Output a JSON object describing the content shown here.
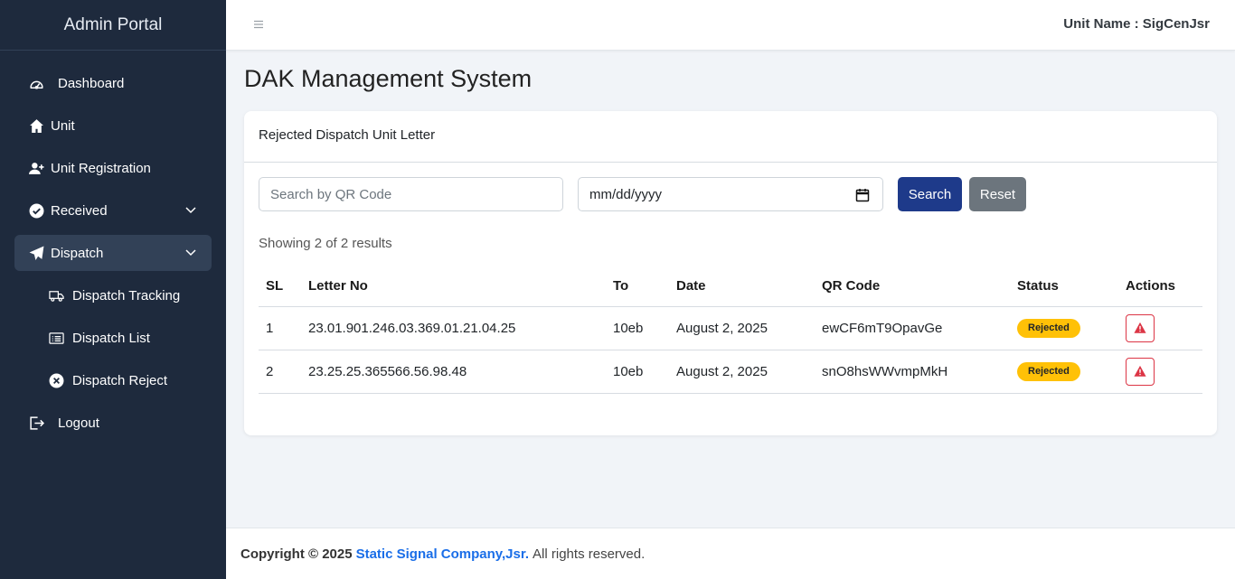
{
  "sidebar": {
    "brand": "Admin Portal",
    "items": [
      {
        "label": "Dashboard",
        "icon": "dashboard-gauge-icon"
      },
      {
        "label": "Unit",
        "icon": "house-icon"
      },
      {
        "label": "Unit Registration",
        "icon": "user-plus-icon"
      },
      {
        "label": "Received",
        "icon": "check-circle-icon"
      },
      {
        "label": "Dispatch",
        "icon": "paper-plane-icon"
      }
    ],
    "dispatch_sub": [
      {
        "label": "Dispatch Tracking",
        "icon": "truck-icon"
      },
      {
        "label": "Dispatch List",
        "icon": "list-icon"
      },
      {
        "label": "Dispatch Reject",
        "icon": "x-circle-icon"
      }
    ],
    "logout": "Logout"
  },
  "topbar": {
    "unit_name": "Unit Name : SigCenJsr"
  },
  "page": {
    "title": "DAK Management System"
  },
  "card": {
    "header": "Rejected Dispatch Unit Letter",
    "search_placeholder": "Search by QR Code",
    "date_placeholder": "mm/dd/yyyy",
    "search_button": "Search",
    "reset_button": "Reset",
    "showing": "Showing 2 of 2 results"
  },
  "table": {
    "columns": [
      "SL",
      "Letter No",
      "To",
      "Date",
      "QR Code",
      "Status",
      "Actions"
    ],
    "rows": [
      {
        "sl": "1",
        "letter_no": "23.01.901.246.03.369.01.21.04.25",
        "to": "10eb",
        "date": "August 2, 2025",
        "qr": "ewCF6mT9OpavGe",
        "status": "Rejected"
      },
      {
        "sl": "2",
        "letter_no": "23.25.25.365566.56.98.48",
        "to": "10eb",
        "date": "August 2, 2025",
        "qr": "snO8hsWWvmpMkH",
        "status": "Rejected"
      }
    ]
  },
  "footer": {
    "copyright": "Copyright © 2025",
    "company": "Static Signal Company,Jsr.",
    "rights": "All rights reserved."
  },
  "colors": {
    "sidebar_bg": "#1e2a3d",
    "active_item_bg": "#324157",
    "primary_button": "#1e3a8a",
    "secondary_button": "#6c757d",
    "badge_warning": "#ffc107",
    "danger": "#dc3545",
    "link": "#1a6ee8"
  }
}
